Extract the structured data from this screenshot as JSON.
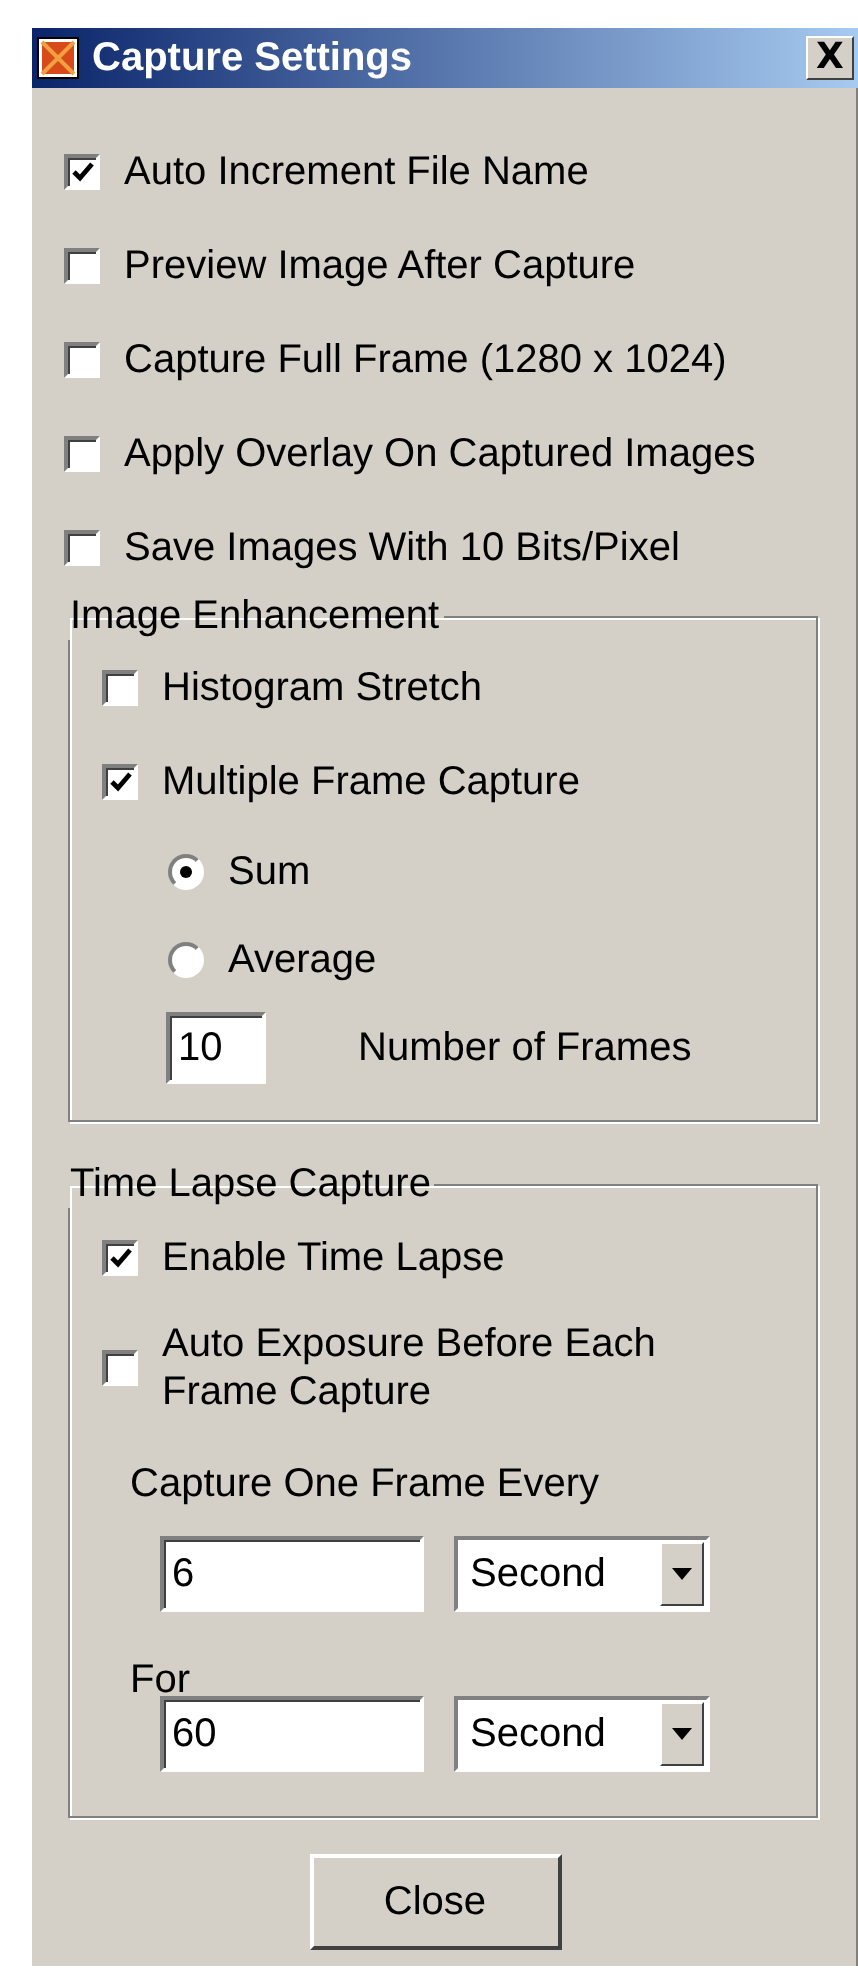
{
  "window": {
    "title": "Capture Settings",
    "close_glyph": "X"
  },
  "options": [
    {
      "label": "Auto Increment File Name",
      "checked": true
    },
    {
      "label": "Preview Image After Capture",
      "checked": false
    },
    {
      "label": "Capture Full Frame (1280 x 1024)",
      "checked": false
    },
    {
      "label": "Apply Overlay On Captured Images",
      "checked": false
    },
    {
      "label": "Save Images With 10 Bits/Pixel",
      "checked": false
    }
  ],
  "image_enhancement": {
    "title": "Image Enhancement",
    "options": [
      {
        "label": "Histogram Stretch",
        "checked": false
      },
      {
        "label": "Multiple Frame Capture",
        "checked": true
      }
    ],
    "modes": [
      {
        "label": "Sum",
        "selected": true
      },
      {
        "label": "Average",
        "selected": false
      }
    ],
    "frames": {
      "value": "10",
      "label": "Number of Frames"
    }
  },
  "time_lapse": {
    "title": "Time Lapse Capture",
    "options": [
      {
        "label": "Enable Time Lapse",
        "checked": true
      },
      {
        "label": "Auto Exposure Before Each Frame Capture",
        "checked": false
      }
    ],
    "intervals": [
      {
        "label": "Capture One Frame Every",
        "value": "6",
        "unit": "Second"
      },
      {
        "label": "For",
        "value": "60",
        "unit": "Second"
      }
    ]
  },
  "buttons": [
    "Close"
  ]
}
